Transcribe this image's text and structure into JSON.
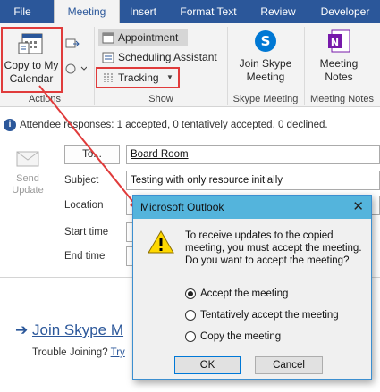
{
  "tabs": [
    "File",
    "Meeting",
    "Insert",
    "Format Text",
    "Review",
    "Developer"
  ],
  "ribbon": {
    "copy_button": "Copy to My Calendar",
    "appointment": "Appointment",
    "scheduling": "Scheduling Assistant",
    "tracking": "Tracking",
    "skype_button": "Join Skype Meeting",
    "notes_button": "Meeting Notes",
    "groups": {
      "actions": "Actions",
      "show": "Show",
      "skype": "Skype Meeting",
      "notes": "Meeting Notes"
    }
  },
  "infobar": "Attendee responses: 1 accepted, 0 tentatively accepted, 0 declined.",
  "form": {
    "send": "Send Update",
    "to_button": "To...",
    "to_value": "Board Room",
    "subject_label": "Subject",
    "subject_value": "Testing with only resource initially",
    "location_label": "Location",
    "start_label": "Start time",
    "end_label": "End time"
  },
  "body": {
    "skype_link": "Join Skype M",
    "trouble": "Trouble Joining?",
    "trouble_link": "Try"
  },
  "dialog": {
    "title": "Microsoft Outlook",
    "message": "To receive updates to the copied meeting, you must accept the meeting. Do you want to accept the meeting?",
    "options": [
      "Accept the meeting",
      "Tentatively accept the meeting",
      "Copy the meeting"
    ],
    "selected": 0,
    "ok": "OK",
    "cancel": "Cancel"
  },
  "colors": {
    "ribbon_blue": "#2b579a",
    "highlight_red": "#e03b3b",
    "dialog_title": "#54b4dc"
  }
}
